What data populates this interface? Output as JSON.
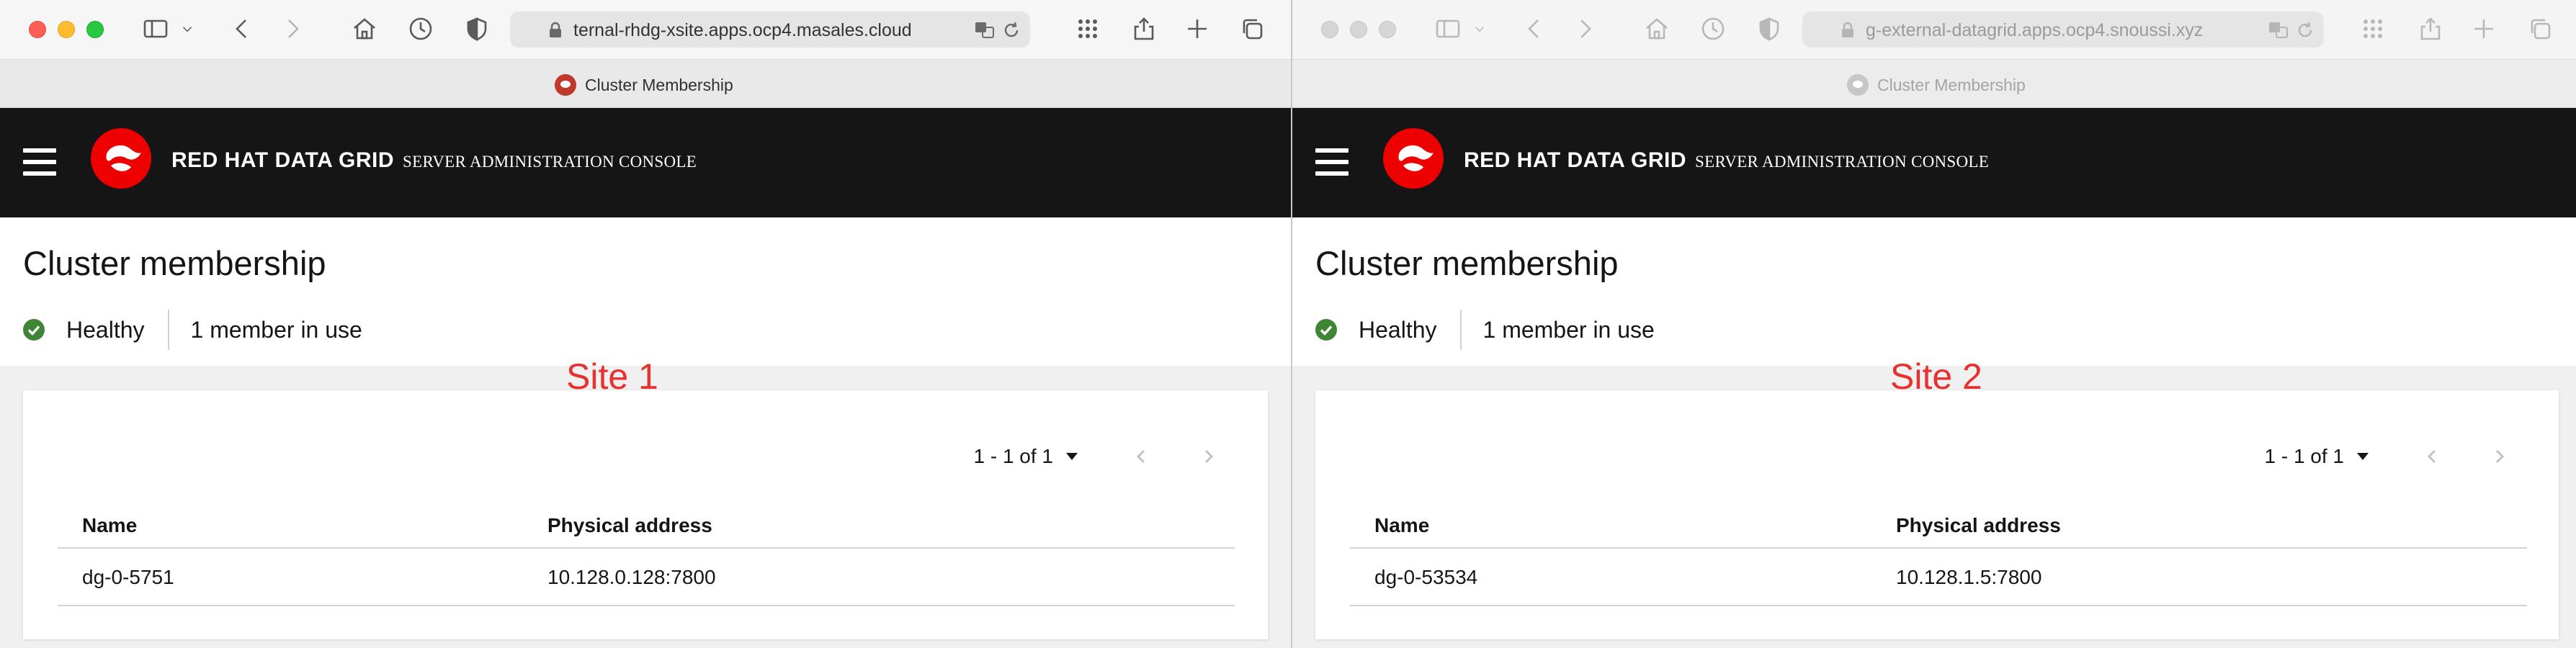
{
  "windows": [
    {
      "url": "ternal-rhdg-xsite.apps.ocp4.masales.cloud",
      "tab_title": "Cluster Membership",
      "brand_main": "RED HAT DATA GRID",
      "brand_sub": "SERVER ADMINISTRATION CONSOLE",
      "page_title": "Cluster membership",
      "status": "Healthy",
      "members_in_use": "1 member in use",
      "site_label": "Site 1",
      "pagination": "1 - 1 of 1",
      "table": {
        "headers": [
          "Name",
          "Physical address"
        ],
        "rows": [
          [
            "dg-0-5751",
            "10.128.0.128:7800"
          ]
        ]
      }
    },
    {
      "url": "g-external-datagrid.apps.ocp4.snoussi.xyz",
      "tab_title": "Cluster Membership",
      "brand_main": "RED HAT DATA GRID",
      "brand_sub": "SERVER ADMINISTRATION CONSOLE",
      "page_title": "Cluster membership",
      "status": "Healthy",
      "members_in_use": "1 member in use",
      "site_label": "Site 2",
      "pagination": "1 - 1 of 1",
      "table": {
        "headers": [
          "Name",
          "Physical address"
        ],
        "rows": [
          [
            "dg-0-53534",
            "10.128.1.5:7800"
          ]
        ]
      }
    }
  ],
  "colors": {
    "masthead_bg": "#151515",
    "logo_red": "#ee0000",
    "healthy_green": "#3e8635",
    "site_label_red": "#e8302e"
  }
}
